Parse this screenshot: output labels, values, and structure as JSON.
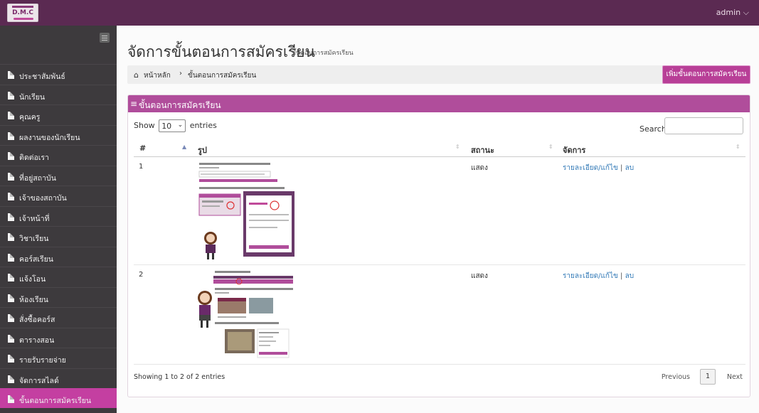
{
  "topbar": {
    "logo_text": "D.M.C",
    "user_label": "admin ⌵"
  },
  "sidebar": {
    "items": [
      {
        "label": "ประชาสัมพันธ์"
      },
      {
        "label": "นักเรียน"
      },
      {
        "label": "คุณครู"
      },
      {
        "label": "ผลงานของนักเรียน"
      },
      {
        "label": "ติดต่อเรา"
      },
      {
        "label": "ที่อยู่สถาบัน"
      },
      {
        "label": "เจ้าของสถาบัน"
      },
      {
        "label": "เจ้าหน้าที่"
      },
      {
        "label": "วิชาเรียน"
      },
      {
        "label": "คอร์สเรียน"
      },
      {
        "label": "แจ้งโอน"
      },
      {
        "label": "ห้องเรียน"
      },
      {
        "label": "สั่งซื้อคอร์ส"
      },
      {
        "label": "ตารางสอน"
      },
      {
        "label": "รายรับรายจ่าย"
      },
      {
        "label": "จัดการสไลด์"
      },
      {
        "label": "ขั้นตอนการสมัครเรียน"
      }
    ],
    "active_index": 16
  },
  "page": {
    "title": "จัดการขั้นตอนการสมัครเรียน",
    "subtitle": "ขั้นตอนการสมัครเรียน",
    "breadcrumb": {
      "home": "หน้าหลัก",
      "separator": "›",
      "current": "ขั้นตอนการสมัครเรียน"
    },
    "add_button": "เพิ่มขั้นตอนการสมัครเรียน"
  },
  "panel": {
    "title": "ขั้นตอนการสมัครเรียน",
    "show_prefix": "Show",
    "page_size": "10",
    "show_suffix": "entries",
    "search_label": "Search:",
    "search_value": "",
    "columns": [
      "#",
      "รูป",
      "สถานะ",
      "จัดการ"
    ],
    "rows": [
      {
        "num": "1",
        "status": "แสดง",
        "action_edit": "รายละเอียด/แก้ไข",
        "action_sep": "|",
        "action_delete": "ลบ"
      },
      {
        "num": "2",
        "status": "แสดง",
        "action_edit": "รายละเอียด/แก้ไข",
        "action_sep": "|",
        "action_delete": "ลบ"
      }
    ],
    "info": "Showing 1 to 2 of 2 entries",
    "pagination": {
      "previous": "Previous",
      "current": "1",
      "next": "Next"
    }
  },
  "colors": {
    "topbar": "#5b2a52",
    "sidebar": "#3d3a3d",
    "accent": "#c43fa1",
    "panel_header": "#b04d9b"
  }
}
